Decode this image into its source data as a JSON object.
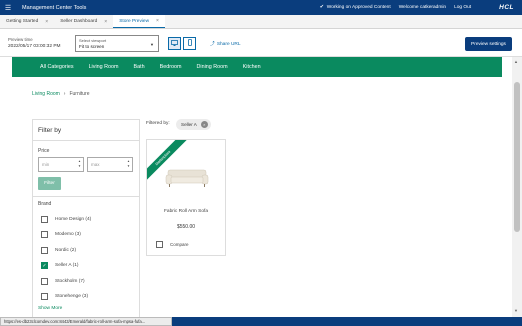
{
  "topbar": {
    "menu_icon": "hamburger-icon",
    "title": "Management Center Tools",
    "status_icon": "checkmark-icon",
    "status_text": "Working on Approved Content",
    "welcome": "Welcome catkeradmin",
    "logout": "Log Out",
    "logo": "HCL"
  },
  "tabs": [
    {
      "label": "Getting Started",
      "close": "×"
    },
    {
      "label": "Seller Dashboard",
      "close": "×"
    },
    {
      "label": "Store Preview",
      "close": "×"
    }
  ],
  "toolbar": {
    "preview_time_label": "Preview time",
    "preview_time_value": "2022/05/17 03:00:32 PM",
    "viewport_label": "Select viewport",
    "viewport_value": "Fit to screen",
    "desktop_icon": "desktop-icon",
    "mobile_icon": "mobile-icon",
    "share_label": "Share URL",
    "preview_settings": "Preview settings"
  },
  "nav": {
    "categories": [
      "All Categories",
      "Living Room",
      "Bath",
      "Bedroom",
      "Dining Room",
      "Kitchen"
    ]
  },
  "breadcrumb": {
    "parent": "Living Room",
    "separator": "›",
    "current": "Furniture"
  },
  "filter": {
    "title": "Filter by",
    "price_label": "Price",
    "min_placeholder": "min",
    "max_placeholder": "max",
    "filter_button": "Filter",
    "brand_label": "Brand",
    "brands": [
      {
        "label": "Home Design (4)",
        "checked": false
      },
      {
        "label": "Modemo (3)",
        "checked": false
      },
      {
        "label": "Nordic (2)",
        "checked": false
      },
      {
        "label": "Seller A (1)",
        "checked": true
      },
      {
        "label": "Stockholm (7)",
        "checked": false
      },
      {
        "label": "Stonehenge (3)",
        "checked": false
      }
    ],
    "show_more": "Show More"
  },
  "filtered_by": {
    "label": "Filtered by:",
    "chip": "Seller A",
    "chip_close": "×"
  },
  "product": {
    "ribbon": "Marketplace",
    "name": "Fabric Roll Arm Sofa",
    "price": "$550.00",
    "compare": "Compare"
  },
  "statusbar": {
    "url": "https://es-db23clcomdev.com:8443/Emerald/fabric-roll-arm-sofa-mpsa-fufa..."
  }
}
